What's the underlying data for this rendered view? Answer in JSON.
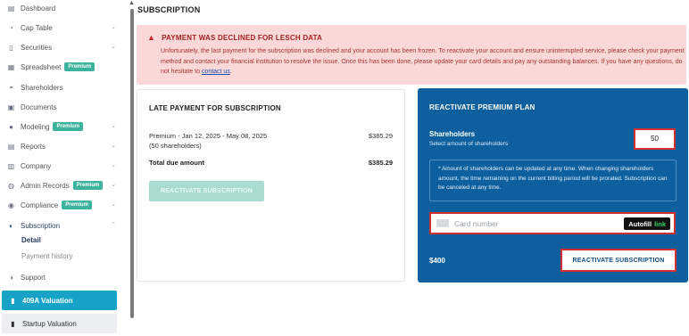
{
  "sidebar": {
    "items": [
      {
        "label": "Dashboard",
        "icon": "dashboard-icon",
        "glyph": "▤"
      },
      {
        "label": "Cap Table",
        "icon": "pie-chart-icon",
        "glyph": "◔"
      },
      {
        "label": "Securities",
        "icon": "document-icon",
        "glyph": "▯"
      },
      {
        "label": "Spreadsheet",
        "icon": "spreadsheet-icon",
        "glyph": "▦",
        "badge": "Premium"
      },
      {
        "label": "Shareholders",
        "icon": "person-icon",
        "glyph": "◓"
      },
      {
        "label": "Documents",
        "icon": "folder-icon",
        "glyph": "▣"
      },
      {
        "label": "Modeling",
        "icon": "bulb-icon",
        "glyph": "●",
        "badge": "Premium"
      },
      {
        "label": "Reports",
        "icon": "report-icon",
        "glyph": "▤"
      },
      {
        "label": "Company",
        "icon": "building-icon",
        "glyph": "▥"
      },
      {
        "label": "Admin Records",
        "icon": "admin-icon",
        "glyph": "◍",
        "badge": "Premium"
      },
      {
        "label": "Compliance",
        "icon": "compliance-icon",
        "glyph": "◉",
        "badge": "Premium"
      },
      {
        "label": "Subscription",
        "icon": "subscription-icon",
        "glyph": "◐"
      }
    ],
    "sub_items": [
      "Detail",
      "Payment history"
    ],
    "support": "Support",
    "valuation_active": "409A Valuation",
    "valuation_inactive": "Startup Valuation"
  },
  "page": {
    "title": "SUBSCRIPTION"
  },
  "alert": {
    "title": "PAYMENT WAS DECLINED FOR LESCH DATA",
    "body": "Unfortunately, the last payment for the subscription was declined and your account has been frozen. To reactivate your account and ensure uninterrupted service, please check your payment method and contact your financial institution to resolve the issue. Once this has been done, please update your card details and pay any outstanding balances. If you have any questions, do not hesitate to ",
    "link": "contact us",
    "tail": "."
  },
  "late_payment": {
    "title": "LATE PAYMENT FOR SUBSCRIPTION",
    "line1": "Premium - Jan 12, 2025 - May 08, 2025",
    "line2": "(50 shareholders)",
    "line_amount": "$385.29",
    "total_label": "Total due amount",
    "total_amount": "$385.29",
    "button": "REACTIVATE SUBSCRIPTION"
  },
  "reactivate": {
    "title": "REACTIVATE PREMIUM PLAN",
    "shareholders_label": "Shareholders",
    "shareholders_sub": "Select amount of shareholders",
    "shareholders_value": "50",
    "note": "* Amount of shareholders can be updated at any time. When changing shareholders amount, the time remaining on the current billing period will be prorated. Subscription can be canceled at any time.",
    "card_placeholder": "Card number",
    "autofill": "Autofill",
    "autofill_link": "link",
    "price": "$400",
    "button": "REACTIVATE SUBSCRIPTION"
  },
  "colors": {
    "accent": "#17a2c8",
    "panel": "#0d5f9e",
    "alert_bg": "#fbd8d8",
    "badge": "#3db39e",
    "highlight": "#d32f2f"
  }
}
